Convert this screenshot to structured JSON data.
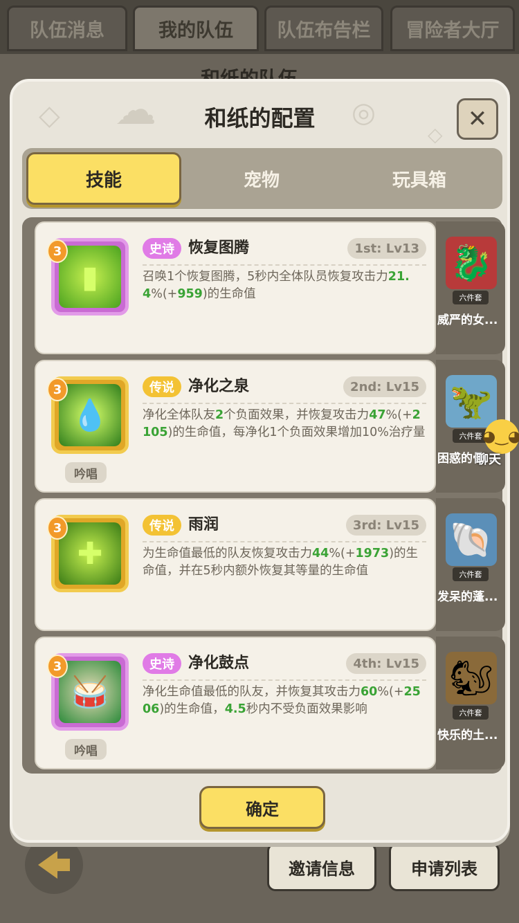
{
  "top_tabs": [
    "队伍消息",
    "我的队伍",
    "队伍布告栏",
    "冒险者大厅"
  ],
  "behind_title": "和纸的队伍",
  "dialog": {
    "title": "和纸的配置",
    "close": "✕",
    "tabs": [
      "技能",
      "宠物",
      "玩具箱"
    ],
    "confirm": "确定"
  },
  "skills": [
    {
      "badge": "3",
      "rarity": "史诗",
      "name": "恢复图腾",
      "slot": "1st: Lv13",
      "chant": "",
      "desc_html": "召唤1个恢复图腾，5秒内全体队员恢复攻击力<b>21.4</b>%(+<b>959</b>)的生命值",
      "pet_name": "威严的女...",
      "pet_set": "六件套"
    },
    {
      "badge": "3",
      "rarity": "传说",
      "name": "净化之泉",
      "slot": "2nd: Lv15",
      "chant": "吟唱",
      "desc_html": "净化全体队友<b>2</b>个负面效果，并恢复攻击力<b>47</b>%(+<b>2105</b>)的生命值，每净化1个负面效果增加10%治疗量",
      "pet_name": "困惑的骨...",
      "pet_set": "六件套"
    },
    {
      "badge": "3",
      "rarity": "传说",
      "name": "雨润",
      "slot": "3rd: Lv15",
      "chant": "",
      "desc_html": "为生命值最低的队友恢复攻击力<b>44</b>%(+<b>1973</b>)的生命值，并在5秒内额外恢复其等量的生命值",
      "pet_name": "发呆的蓬...",
      "pet_set": "六件套"
    },
    {
      "badge": "3",
      "rarity": "史诗",
      "name": "净化鼓点",
      "slot": "4th: Lv15",
      "chant": "吟唱",
      "desc_html": "净化生命值最低的队友，并恢复其攻击力<b>60</b>%(+<b>2506</b>)的生命值，<b>4.5</b>秒内不受负面效果影响",
      "pet_name": "快乐的土...",
      "pet_set": "六件套"
    }
  ],
  "bottom": {
    "invite": "邀请信息",
    "apply": "申请列表"
  },
  "chat": {
    "label": "聊天"
  }
}
